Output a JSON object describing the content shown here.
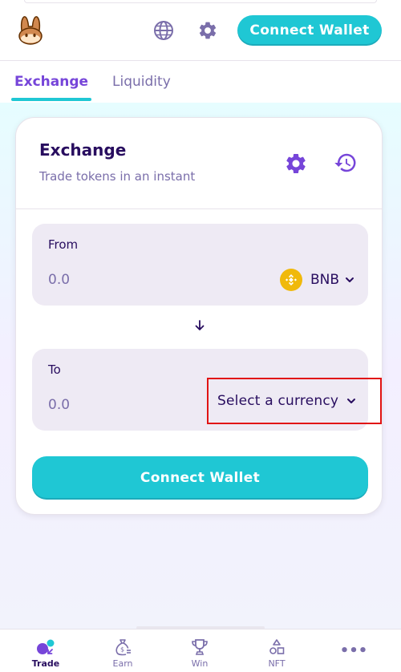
{
  "header": {
    "logo_icon": "pancake-bunny-logo",
    "language_icon": "globe-icon",
    "settings_icon": "gear-icon",
    "connect_label": "Connect Wallet"
  },
  "subnav": {
    "tabs": [
      {
        "label": "Exchange",
        "active": true
      },
      {
        "label": "Liquidity",
        "active": false
      }
    ]
  },
  "card": {
    "title": "Exchange",
    "subtitle": "Trade tokens in an instant",
    "settings_icon": "gear-icon",
    "history_icon": "history-icon"
  },
  "from": {
    "label": "From",
    "amount_placeholder": "0.0",
    "token": "BNB",
    "token_icon": "bnb-icon"
  },
  "swap_icon": "arrow-down-icon",
  "to": {
    "label": "To",
    "amount_placeholder": "0.0",
    "select_label": "Select a currency"
  },
  "connect_button": "Connect Wallet",
  "colors": {
    "primary": "#1fc7d4",
    "secondary": "#7645d9",
    "text": "#280d5f",
    "text_subtle": "#7a6eaa",
    "input_bg": "#eeeaf4",
    "highlight_box": "#e11414",
    "bnb": "#f0b90b"
  },
  "bottom_nav": [
    {
      "label": "Trade",
      "icon": "trade-icon",
      "active": true
    },
    {
      "label": "Earn",
      "icon": "money-bag-icon",
      "active": false
    },
    {
      "label": "Win",
      "icon": "trophy-icon",
      "active": false
    },
    {
      "label": "NFT",
      "icon": "nft-shapes-icon",
      "active": false
    }
  ],
  "more_label": "•••"
}
